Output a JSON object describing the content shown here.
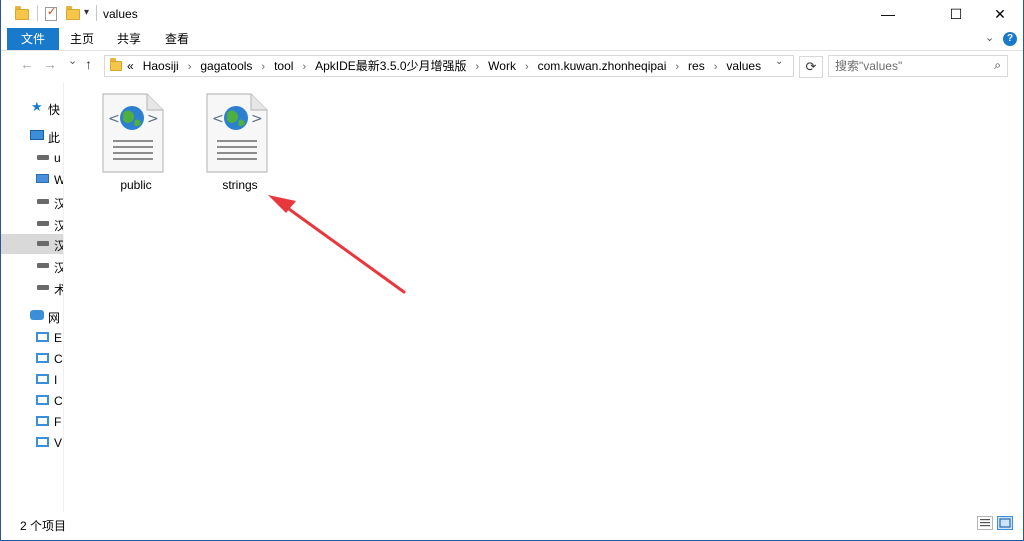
{
  "window": {
    "title": "values",
    "minimize_glyph": "—",
    "maximize_glyph": "☐",
    "close_glyph": "✕"
  },
  "ribbon": {
    "tabs": [
      "文件",
      "主页",
      "共享",
      "查看"
    ],
    "collapse_glyph": "⌄",
    "help_glyph": "?"
  },
  "nav": {
    "back_glyph": "←",
    "forward_glyph": "→",
    "recent_glyph": "⌄",
    "up_glyph": "↑"
  },
  "address": {
    "overflow": "«",
    "separator": "›",
    "breadcrumb": [
      "Haosiji",
      "gagatools",
      "tool",
      "ApkIDE最新3.5.0少月增强版",
      "Work",
      "com.kuwan.zhonheqipai",
      "res",
      "values"
    ],
    "dropdown_glyph": "⌄",
    "refresh_glyph": "⟳"
  },
  "search": {
    "placeholder": "搜索\"values\"",
    "icon_glyph": "⌕"
  },
  "navpane": {
    "items": [
      {
        "label": "快",
        "icon": "star-icon"
      },
      {
        "label": "此",
        "icon": "pc-icon"
      },
      {
        "label": "u",
        "icon": "drive-icon"
      },
      {
        "label": "W",
        "icon": "network-drive-icon"
      },
      {
        "label": "汉",
        "icon": "drive-icon"
      },
      {
        "label": "汉",
        "icon": "drive-icon"
      },
      {
        "label": "汉",
        "icon": "drive-icon"
      },
      {
        "label": "汉",
        "icon": "drive-icon"
      },
      {
        "label": "术",
        "icon": "drive-icon"
      },
      {
        "label": "网",
        "icon": "network-icon"
      },
      {
        "label": "E",
        "icon": "monitor-icon"
      },
      {
        "label": "C",
        "icon": "monitor-icon"
      },
      {
        "label": "I",
        "icon": "monitor-icon"
      },
      {
        "label": "C",
        "icon": "monitor-icon"
      },
      {
        "label": "F",
        "icon": "monitor-icon"
      },
      {
        "label": "V",
        "icon": "monitor-icon"
      }
    ]
  },
  "files": [
    {
      "name": "public",
      "icon": "xml-document-icon"
    },
    {
      "name": "strings",
      "icon": "xml-document-icon"
    }
  ],
  "annotation": {
    "color": "#e8383d"
  },
  "status": {
    "item_count": "2 个项目"
  },
  "colors": {
    "accent": "#1979ca",
    "border": "#2b579a"
  }
}
